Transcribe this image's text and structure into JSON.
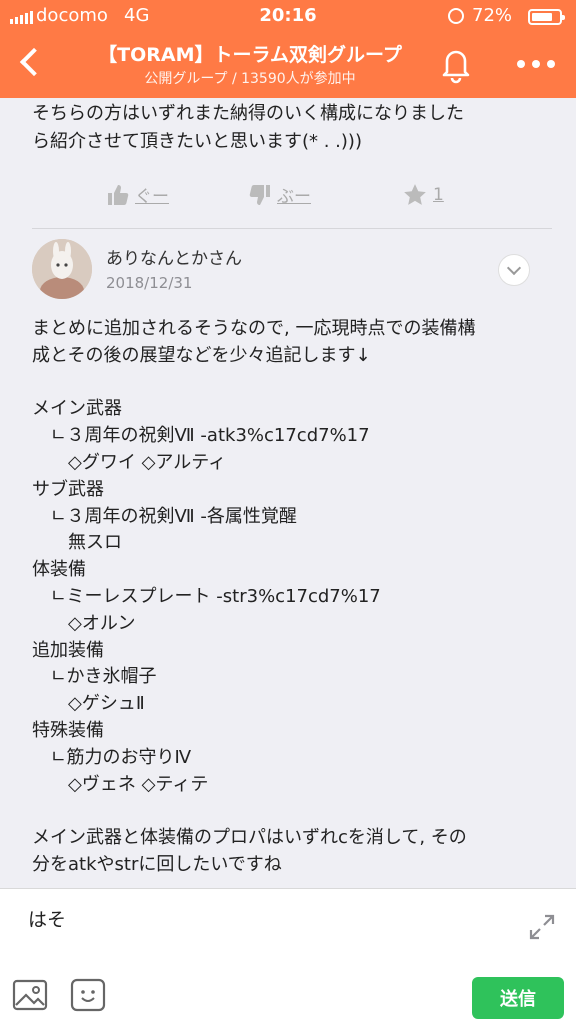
{
  "status_bar": {
    "carrier": "docomo",
    "network": "4G",
    "time": "20:16",
    "battery": "72%"
  },
  "header": {
    "title": "【TORAM】トーラム双剣グループ",
    "subtitle": "公開グループ / 13590人が参加中",
    "icons": [
      "back-icon",
      "bell-icon",
      "more-icon"
    ]
  },
  "previous_post": {
    "text": "そちらの方はいずれまた納得のいく構成になりました\nら紹介させて頂きたいと思います(* . .)))",
    "reactions": {
      "good_label": "ぐー",
      "bad_label": "ぶー",
      "star_count": "1"
    }
  },
  "post": {
    "author": "ありなんとかさん",
    "date": "2018/12/31",
    "body": "まとめに追加されるそうなので, 一応現時点での装備構\n成とその後の展望などを少々追記します↓\n\nメイン武器\n　ㄴ３周年の祝剣Ⅶ -atk3%c17cd7%17\n　　◇グワイ ◇アルティ\nサブ武器\n　ㄴ３周年の祝剣Ⅶ -各属性覚醒\n　　無スロ\n体装備\n　ㄴミーレスプレート -str3%c17cd7%17\n　　◇オルン\n追加装備\n　ㄴかき氷帽子\n　　◇ゲシュⅡ\n特殊装備\n　ㄴ筋力のお守りⅣ\n　　◇ヴェネ ◇ティテ\n\nメイン武器と体装備のプロパはいずれcを消して, その\n分をatkやstrに回したいですね"
  },
  "composer": {
    "input_value": "はそ",
    "send_label": "送信"
  },
  "colors": {
    "header": "#ff7a45",
    "send": "#2fc25b",
    "background": "#efeff4"
  }
}
